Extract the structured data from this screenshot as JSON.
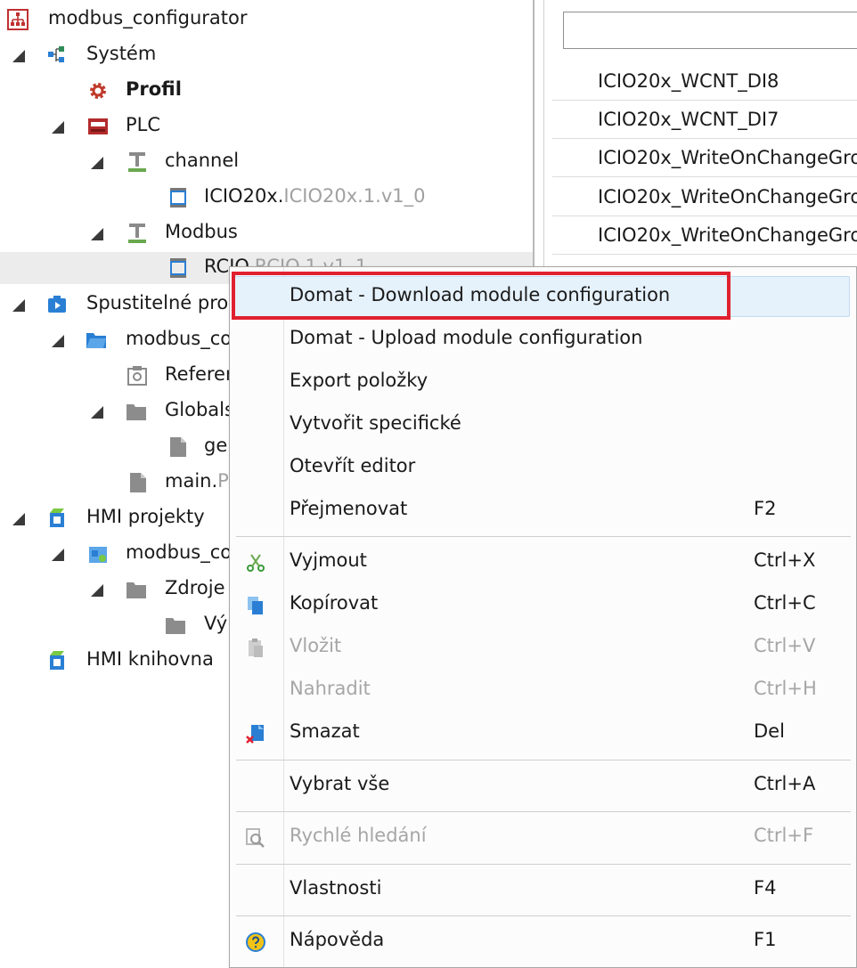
{
  "tree": {
    "root": "modbus_configurator",
    "system": "Systém",
    "profil": "Profil",
    "plc": "PLC",
    "channel": "channel",
    "icio_name": "ICIO20x.",
    "icio_ext": "ICIO20x.1.v1_0",
    "modbus": "Modbus",
    "rcio_name": "RCIO.",
    "rcio_ext": "RCIO.1.v1_1",
    "spustitelne": "Spustitelné pro",
    "modbus_co1": "modbus_co",
    "referen": "Referen",
    "globals": "Globals",
    "ge": "ge",
    "main_name": "main.",
    "main_ext": "P",
    "hmi_projekty": "HMI projekty",
    "modbus_co2": "modbus_co",
    "zdroje": "Zdroje",
    "vy": "Vý",
    "hmi_knihovna": "HMI knihovna"
  },
  "right_list": {
    "search_placeholder": "",
    "rows": [
      "ICIO20x_WCNT_DI8",
      "ICIO20x_WCNT_DI7",
      "ICIO20x_WriteOnChangeGro",
      "ICIO20x_WriteOnChangeGro",
      "ICIO20x_WriteOnChangeGro"
    ]
  },
  "menu": {
    "download": {
      "label": "Domat - Download module configuration",
      "key": ""
    },
    "upload": {
      "label": "Domat - Upload module configuration",
      "key": ""
    },
    "export": {
      "label": "Export položky",
      "key": ""
    },
    "create": {
      "label": "Vytvořit specifické",
      "key": ""
    },
    "open": {
      "label": "Otevřít editor",
      "key": ""
    },
    "rename": {
      "label": "Přejmenovat",
      "key": "F2"
    },
    "cut": {
      "label": "Vyjmout",
      "key": "Ctrl+X"
    },
    "copy": {
      "label": "Kopírovat",
      "key": "Ctrl+C"
    },
    "paste": {
      "label": "Vložit",
      "key": "Ctrl+V"
    },
    "replace": {
      "label": "Nahradit",
      "key": "Ctrl+H"
    },
    "delete": {
      "label": "Smazat",
      "key": "Del"
    },
    "select_all": {
      "label": "Vybrat vše",
      "key": "Ctrl+A"
    },
    "quick_search": {
      "label": "Rychlé hledání",
      "key": "Ctrl+F"
    },
    "properties": {
      "label": "Vlastnosti",
      "key": "F4"
    },
    "help": {
      "label": "Nápověda",
      "key": "F1"
    }
  },
  "colors": {
    "highlight": "#e5f1fb",
    "red_frame": "#e0202e",
    "accent_blue": "#2a7fd4"
  }
}
